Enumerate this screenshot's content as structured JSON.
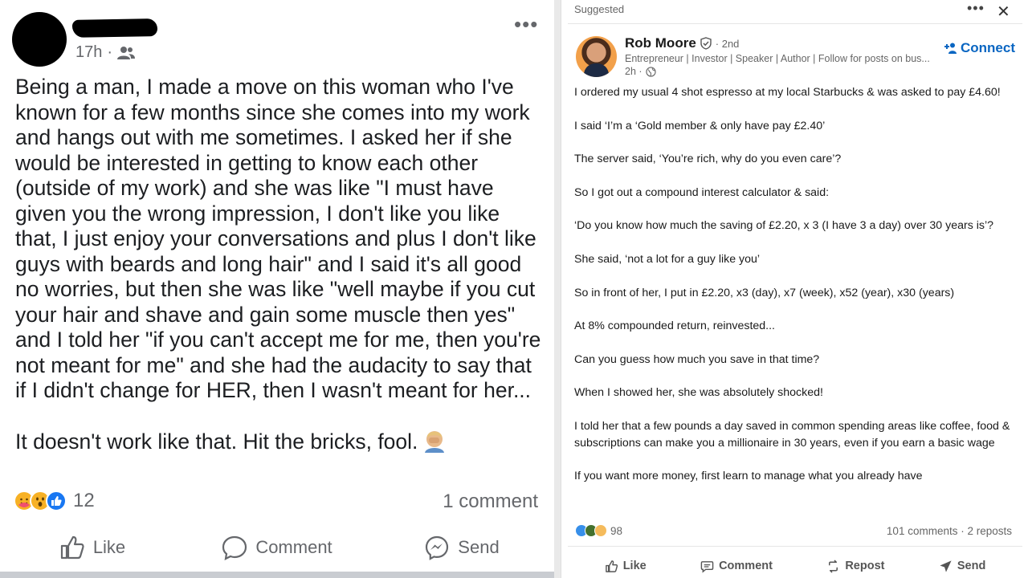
{
  "facebook_post": {
    "timestamp": "17h",
    "audience_icon": "friends-icon",
    "more_icon": "•••",
    "paragraph1": "Being a man, I made a move on this woman who I've known for a few months since she comes into my work and hangs out with me sometimes. I asked her if she would be interested in getting to know each other (outside of my work) and she was like \"I must have given you the wrong impression, I don't like you like that, I just enjoy your conversations and plus I don't like guys with beards and long hair\" and I said it's all good no worries, but then she was like \"well maybe if you cut your hair and shave and gain some muscle then yes\" and I told her \"if you can't accept me for me, then you're not meant for me\" and she had the audacity to say that if I didn't change for HER, then I wasn't meant for her...",
    "paragraph2": "It doesn't work like that. Hit the bricks, fool.",
    "reaction_count": "12",
    "comment_count": "1 comment",
    "actions": {
      "like": "Like",
      "comment": "Comment",
      "send": "Send"
    },
    "colors": {
      "text": "#1c1e21",
      "muted": "#65676b"
    }
  },
  "linkedin_post": {
    "suggested_label": "Suggested",
    "more_icon": "•••",
    "close_icon": "✕",
    "author": {
      "name": "Rob Moore",
      "degree": "· 2nd",
      "headline": "Entrepreneur | Investor | Speaker | Author | Follow for posts on bus...",
      "time": "2h ·"
    },
    "connect_label": "Connect",
    "paragraphs": [
      "I ordered my usual 4 shot espresso at my local Starbucks & was asked to pay £4.60!",
      "I said ‘I’m a ‘Gold member & only have pay £2.40’",
      "The server said, ‘You’re rich, why do you even care’?",
      "So I got out a compound interest calculator & said:",
      "‘Do you know how much the saving of £2.20, x 3 (I have 3 a day) over 30 years is’?",
      "She said, ‘not a lot for a guy like you’",
      "So in front of her, I put in £2.20, x3 (day), x7 (week), x52 (year), x30 (years)",
      "At 8% compounded return, reinvested...",
      "Can you guess how much you save in that time?",
      "When I showed her, she was absolutely shocked!",
      "I told her that a few pounds a day saved in common spending areas like coffee, food & subscriptions can make you a millionaire in 30 years, even if you earn a basic wage",
      "If you want more money, first learn to manage what you already have"
    ],
    "reaction_count": "98",
    "stats": "101 comments · 2 reposts",
    "actions": {
      "like": "Like",
      "comment": "Comment",
      "repost": "Repost",
      "send": "Send"
    },
    "colors": {
      "accent": "#0a66c2",
      "muted": "#666666"
    }
  }
}
